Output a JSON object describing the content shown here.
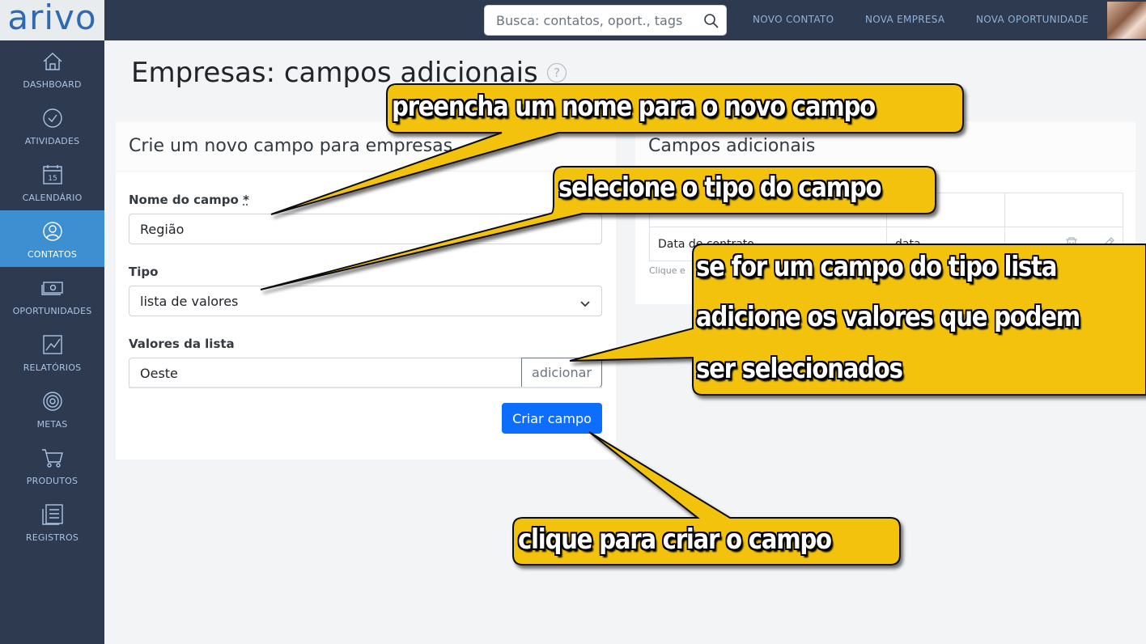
{
  "app": {
    "logo": "arivo"
  },
  "sidebar": {
    "items": [
      {
        "label": "DASHBOARD",
        "icon": "house-icon"
      },
      {
        "label": "ATIVIDADES",
        "icon": "check-circle-icon"
      },
      {
        "label": "CALENDÁRIO",
        "icon": "calendar-icon",
        "day": "15"
      },
      {
        "label": "CONTATOS",
        "icon": "person-icon",
        "active": true
      },
      {
        "label": "OPORTUNIDADES",
        "icon": "money-icon"
      },
      {
        "label": "RELATÓRIOS",
        "icon": "chart-icon"
      },
      {
        "label": "METAS",
        "icon": "target-icon"
      },
      {
        "label": "PRODUTOS",
        "icon": "cart-icon"
      },
      {
        "label": "REGISTROS",
        "icon": "records-icon"
      }
    ]
  },
  "topbar": {
    "search_placeholder": "Busca: contatos, oport., tags",
    "links": [
      "NOVO CONTATO",
      "NOVA EMPRESA",
      "NOVA OPORTUNIDADE"
    ]
  },
  "page": {
    "title": "Empresas: campos adicionais",
    "help": "?"
  },
  "form": {
    "header": "Crie um novo campo para empresas",
    "name_label": "Nome do campo",
    "required_mark": "*",
    "name_value": "Região",
    "type_label": "Tipo",
    "type_value": "lista de valores",
    "list_label": "Valores da lista",
    "list_value": "Oeste",
    "add_label": "adicionar",
    "submit_label": "Criar campo"
  },
  "fields_panel": {
    "header": "Campos adicionais",
    "rows": [
      {
        "name": "",
        "type": ""
      },
      {
        "name": "Data de contrato",
        "type": "data"
      }
    ],
    "hint": "Clique e"
  },
  "callouts": {
    "name": "preencha um nome para o novo campo",
    "type": "selecione o tipo do campo",
    "list_1": "se for um campo do tipo lista",
    "list_2": "adicione os valores que podem",
    "list_3": "ser selecionados",
    "submit": "clique para criar o campo",
    "color": "#f2c20f"
  }
}
